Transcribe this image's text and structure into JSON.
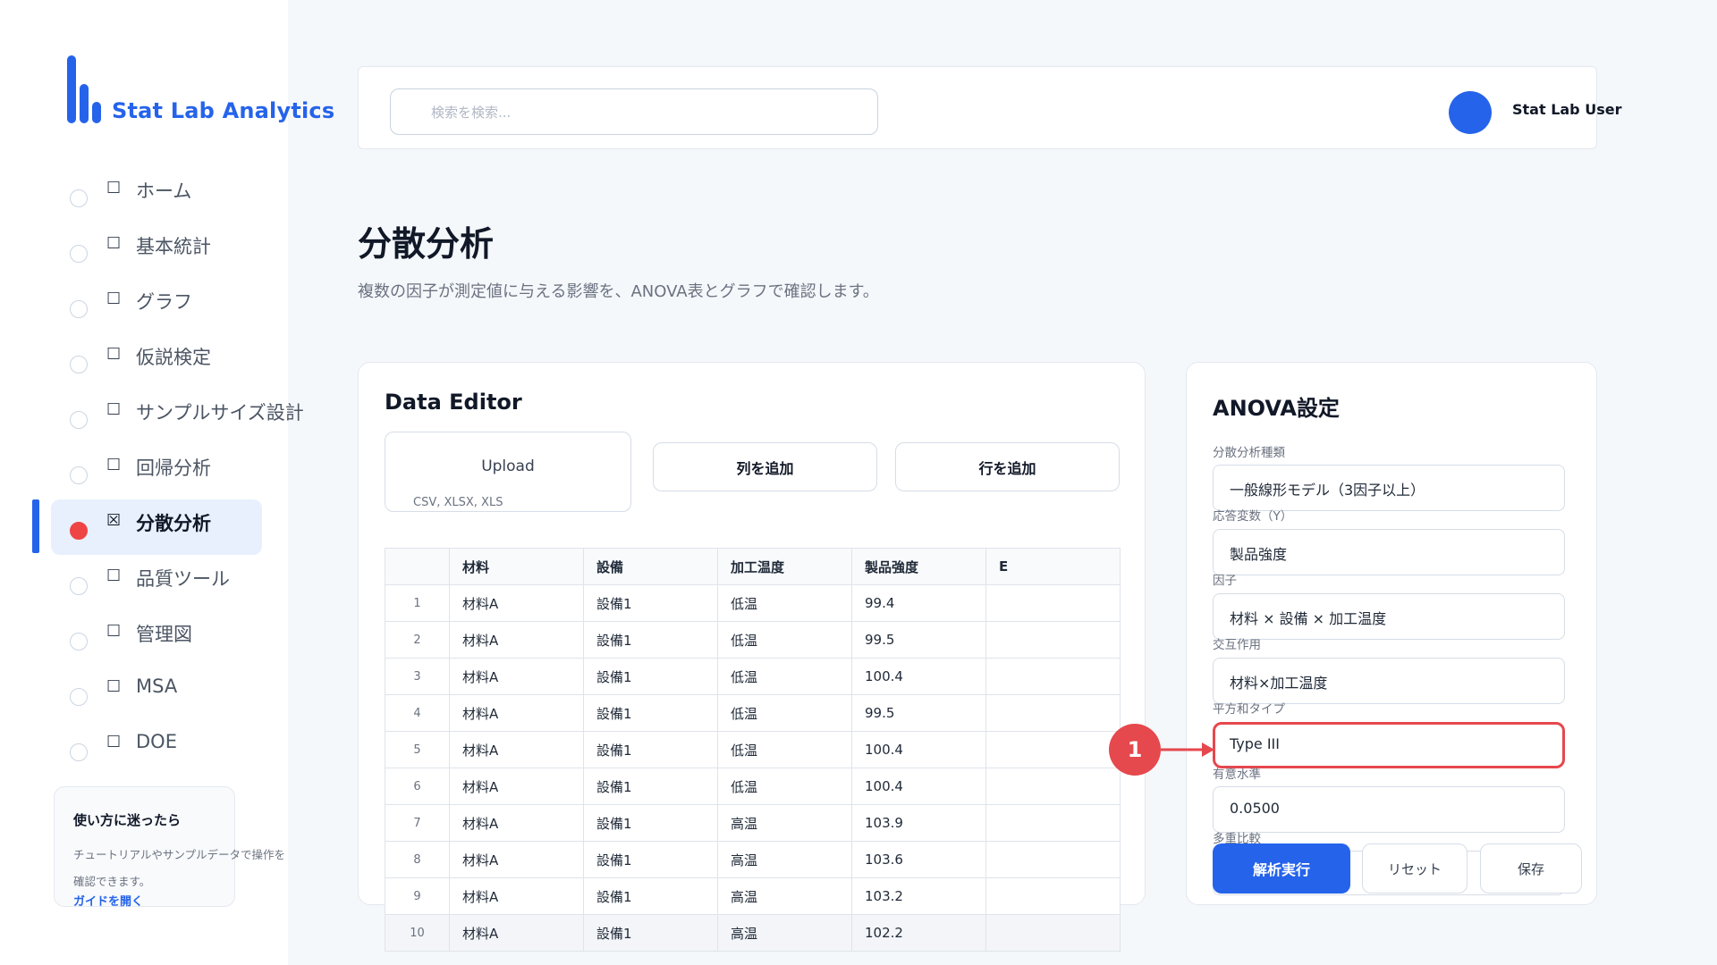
{
  "brand": {
    "name": "Stat Lab Analytics",
    "color": "#2563eb"
  },
  "sidebar": {
    "items": [
      {
        "label": "ホーム",
        "icon": "☐",
        "active": false
      },
      {
        "label": "基本統計",
        "icon": "☐",
        "active": false
      },
      {
        "label": "グラフ",
        "icon": "☐",
        "active": false
      },
      {
        "label": "仮説検定",
        "icon": "☐",
        "active": false
      },
      {
        "label": "サンプルサイズ設計",
        "icon": "☐",
        "active": false
      },
      {
        "label": "回帰分析",
        "icon": "☐",
        "active": false
      },
      {
        "label": "分散分析",
        "icon": "☒",
        "active": true
      },
      {
        "label": "品質ツール",
        "icon": "☐",
        "active": false
      },
      {
        "label": "管理図",
        "icon": "☐",
        "active": false
      },
      {
        "label": "MSA",
        "icon": "☐",
        "active": false
      },
      {
        "label": "DOE",
        "icon": "☐",
        "active": false
      }
    ],
    "help": {
      "title": "使い方に迷ったら",
      "body": "チュートリアルやサンプルデータで操作を確認できます。",
      "link": "ガイドを開く"
    }
  },
  "header": {
    "search_placeholder": "検索を検索...",
    "user": "Stat Lab User"
  },
  "page": {
    "title": "分散分析",
    "subtitle": "複数の因子が測定値に与える影響を、ANOVA表とグラフで確認します。"
  },
  "editor": {
    "title": "Data Editor",
    "upload_label": "Upload",
    "upload_formats": "CSV, XLSX, XLS",
    "add_column": "列を追加",
    "add_row": "行を追加",
    "columns": [
      "",
      "材料",
      "設備",
      "加工温度",
      "製品強度",
      "E"
    ],
    "rows": [
      [
        "1",
        "材料A",
        "設備1",
        "低温",
        "99.4",
        ""
      ],
      [
        "2",
        "材料A",
        "設備1",
        "低温",
        "99.5",
        ""
      ],
      [
        "3",
        "材料A",
        "設備1",
        "低温",
        "100.4",
        ""
      ],
      [
        "4",
        "材料A",
        "設備1",
        "低温",
        "99.5",
        ""
      ],
      [
        "5",
        "材料A",
        "設備1",
        "低温",
        "100.4",
        ""
      ],
      [
        "6",
        "材料A",
        "設備1",
        "低温",
        "100.4",
        ""
      ],
      [
        "7",
        "材料A",
        "設備1",
        "高温",
        "103.9",
        ""
      ],
      [
        "8",
        "材料A",
        "設備1",
        "高温",
        "103.6",
        ""
      ],
      [
        "9",
        "材料A",
        "設備1",
        "高温",
        "103.2",
        ""
      ],
      [
        "10",
        "材料A",
        "設備1",
        "高温",
        "102.2",
        ""
      ]
    ]
  },
  "settings": {
    "title": "ANOVA設定",
    "fields": [
      {
        "label": "分散分析種類",
        "value": "一般線形モデル（3因子以上）"
      },
      {
        "label": "応答変数（Y）",
        "value": "製品強度"
      },
      {
        "label": "因子",
        "value": "材料 × 設備 × 加工温度"
      },
      {
        "label": "交互作用",
        "value": "材料×加工温度"
      },
      {
        "label": "平方和タイプ",
        "value": "Type III"
      },
      {
        "label": "有意水準",
        "value": "0.0500"
      },
      {
        "label": "多重比較",
        "value": ""
      }
    ],
    "run": "解析実行",
    "reset": "リセット",
    "save": "保存"
  },
  "annotation": {
    "number": "1",
    "color": "#e5484d"
  }
}
